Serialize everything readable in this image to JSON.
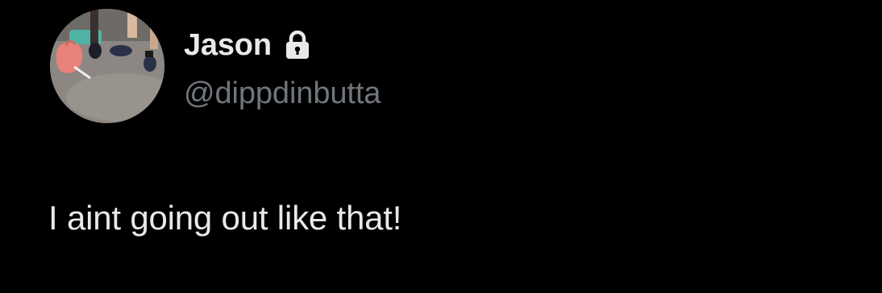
{
  "tweet": {
    "author": {
      "display_name": "Jason",
      "handle": "@dippdinbutta",
      "protected_icon": "lock-icon",
      "avatar": "avatar-photo"
    },
    "text": "I aint going out like that!"
  },
  "colors": {
    "background": "#000000",
    "primary_text": "#e7e9ea",
    "secondary_text": "#71767b"
  }
}
